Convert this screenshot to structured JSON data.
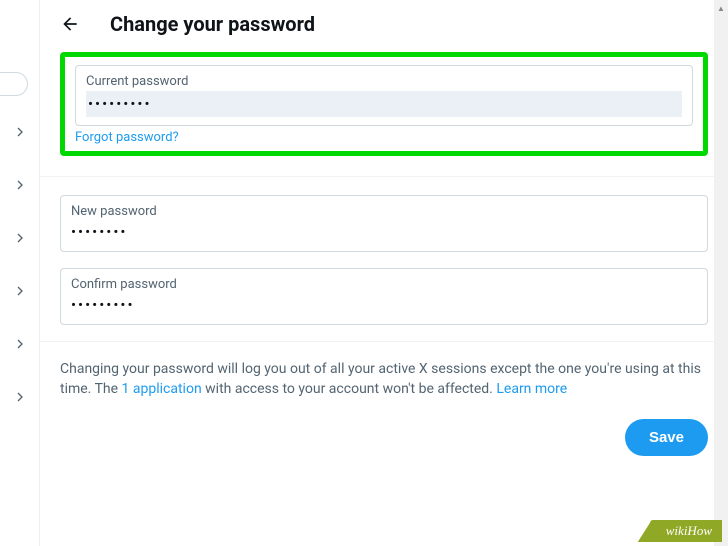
{
  "header": {
    "title": "Change your password"
  },
  "fields": {
    "current": {
      "label": "Current password",
      "value": "•••••••••"
    },
    "forgot_link": "Forgot password?",
    "new": {
      "label": "New password",
      "value": "••••••••"
    },
    "confirm": {
      "label": "Confirm password",
      "value": "•••••••••"
    }
  },
  "info": {
    "text_before": "Changing your password will log you out of all your active X sessions except the one you're using at this time. The ",
    "link1": "1 application",
    "text_mid": " with access to your account won't be affected. ",
    "link2": "Learn more"
  },
  "buttons": {
    "save": "Save"
  },
  "watermark": "wikiHow"
}
